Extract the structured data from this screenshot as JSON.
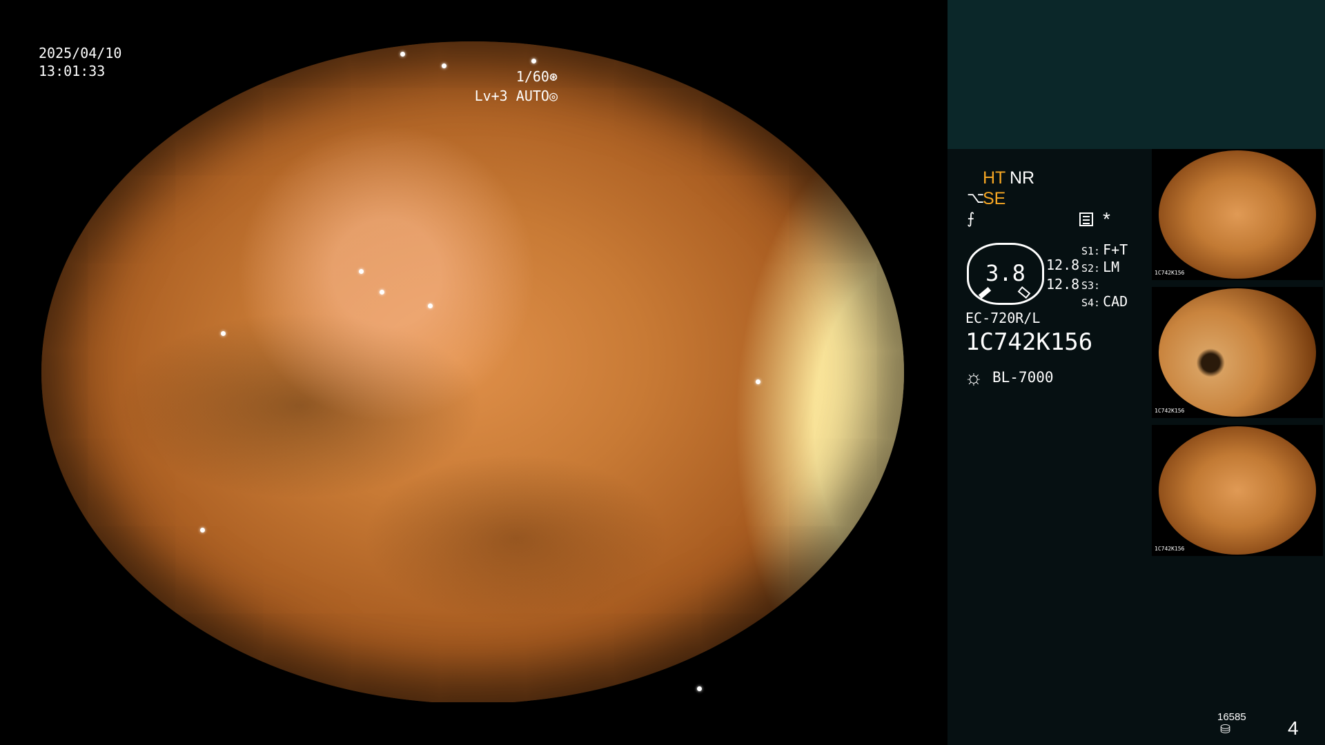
{
  "overlay": {
    "date": "2025/04/10",
    "time": "13:01:33",
    "shutter": "1/60",
    "shutter_icon": "⊛",
    "iris_level": "Lv+3",
    "iris_mode": "AUTO",
    "iris_icon": "◎"
  },
  "status": {
    "ht": "HT",
    "nr": "NR",
    "se_icon": "⌥",
    "se": "SE",
    "enhance_icon": "⨍",
    "star": "*",
    "gauge_value": "3.8",
    "value_1": "12.8",
    "value_2": "12.8",
    "switches": [
      {
        "key": "S1:",
        "value": "F+T"
      },
      {
        "key": "S2:",
        "value": "LM"
      },
      {
        "key": "S3:",
        "value": ""
      },
      {
        "key": "S4:",
        "value": "CAD"
      }
    ],
    "scope_model": "EC-720R/L",
    "scope_serial": "1C742K156",
    "light_icon": "☼",
    "light_source": "BL-7000"
  },
  "thumbnails": [
    {
      "caption": "1C742K156"
    },
    {
      "caption": "1C742K156"
    },
    {
      "caption": "1C742K156"
    }
  ],
  "footer": {
    "counter": "16585",
    "counter_icon": "⛁",
    "page": "4"
  },
  "colors": {
    "accent": "#f5a623",
    "panel_bg": "#061012",
    "panel_top": "#0b2729"
  }
}
